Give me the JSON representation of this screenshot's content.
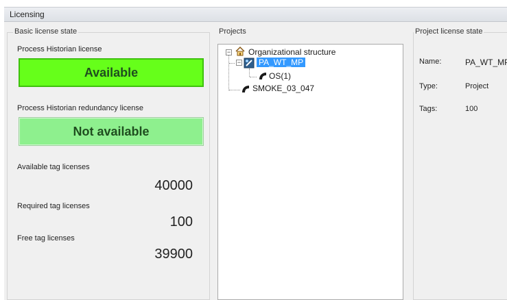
{
  "window": {
    "title": "Licensing"
  },
  "basic": {
    "group_title": "Basic license state",
    "ph_license_label": "Process Historian license",
    "ph_license_state": "Available",
    "redundancy_label": "Process Historian redundancy license",
    "redundancy_state": "Not available",
    "available_tags_label": "Available tag licenses",
    "available_tags_value": "40000",
    "required_tags_label": "Required tag licenses",
    "required_tags_value": "100",
    "free_tags_label": "Free tag licenses",
    "free_tags_value": "39900"
  },
  "projects": {
    "group_title": "Projects",
    "tree": {
      "root": "Organizational structure",
      "project_selected": "PA_WT_MP",
      "child": "OS(1)",
      "project_2": "SMOKE_03_047"
    }
  },
  "project_state": {
    "group_title": "Project license state",
    "name_label": "Name:",
    "name_value": "PA_WT_MP",
    "type_label": "Type:",
    "type_value": "Project",
    "tags_label": "Tags:",
    "tags_value": "100"
  },
  "colors": {
    "available": "#66ff1a",
    "not_available": "#8ef08e",
    "selection": "#3399ff"
  }
}
